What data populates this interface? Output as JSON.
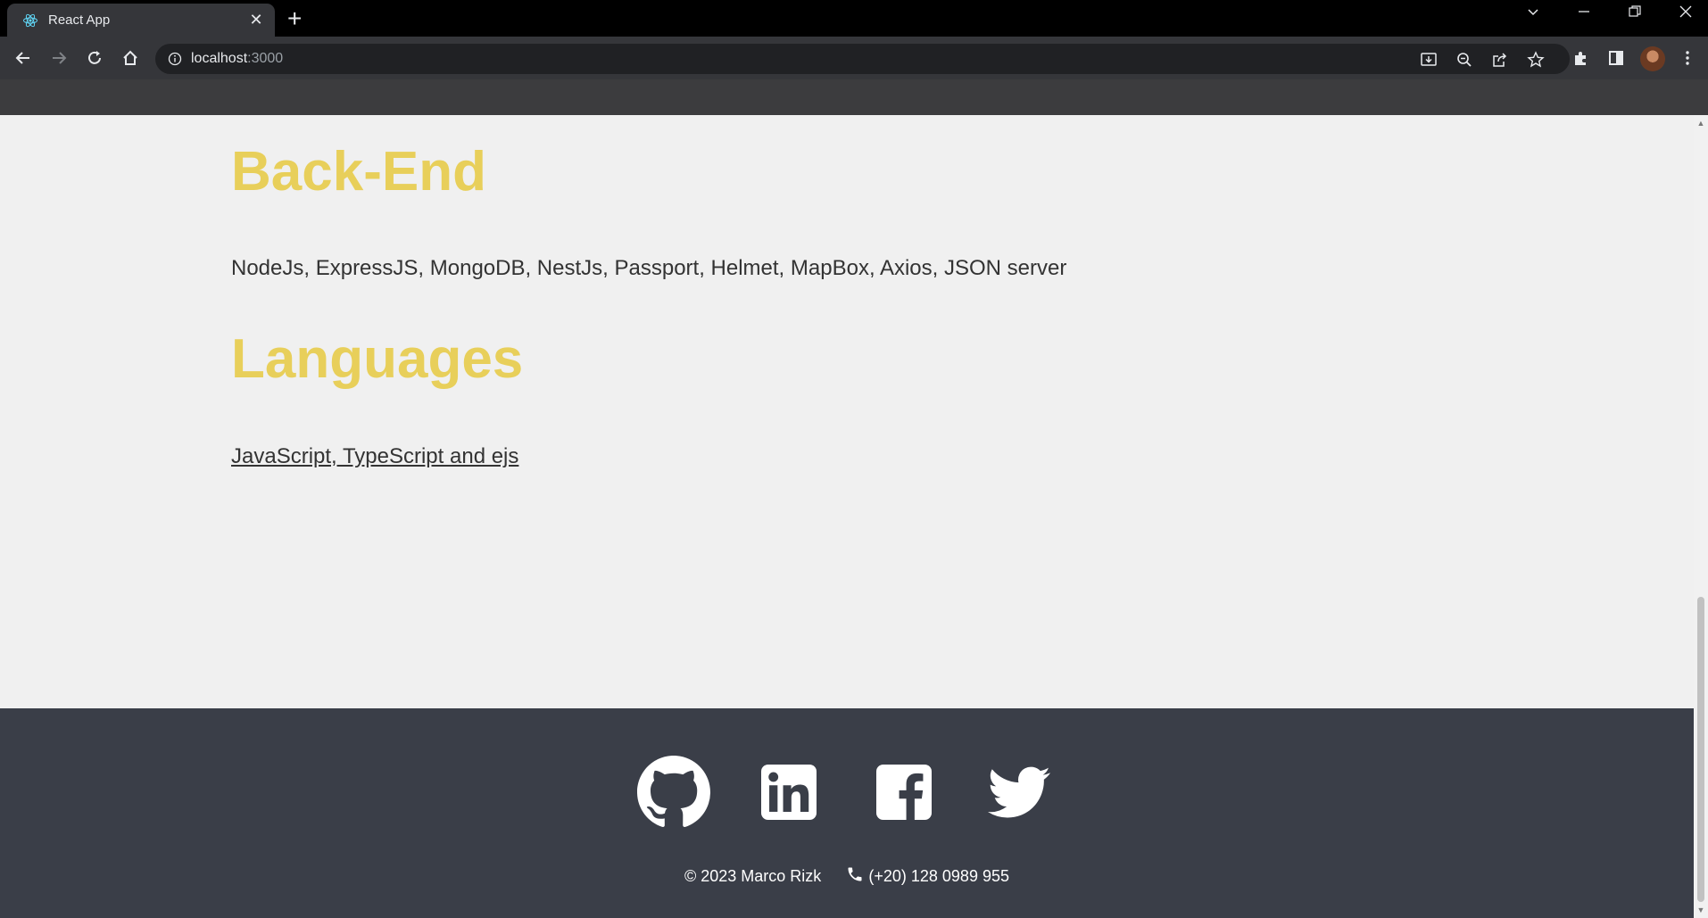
{
  "browser": {
    "tab_title": "React App",
    "url_host": "localhost",
    "url_port": ":3000"
  },
  "sections": [
    {
      "heading": "Back-End",
      "text": "NodeJs, ExpressJS, MongoDB, NestJs, Passport, Helmet, MapBox, Axios, JSON server"
    },
    {
      "heading": "Languages",
      "text": "JavaScript, TypeScript and ejs"
    }
  ],
  "footer": {
    "social_icons": [
      "github-icon",
      "linkedin-icon",
      "facebook-icon",
      "twitter-icon"
    ],
    "copyright": "© 2023 Marco Rizk",
    "phone": "(+20) 128 0989 955"
  },
  "colors": {
    "heading": "#e8cf5a",
    "footer_bg": "#3a3e48",
    "page_bg": "#f0f0f0"
  }
}
